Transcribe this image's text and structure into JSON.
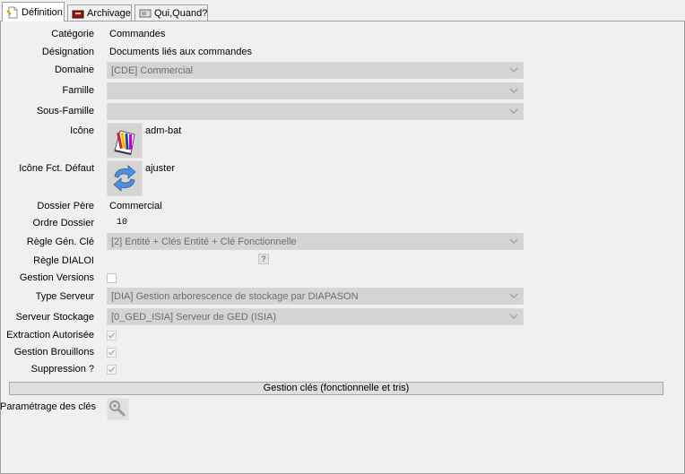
{
  "tabs": [
    {
      "label": "Définition",
      "icon": "document-icon",
      "active": true
    },
    {
      "label": "Archivage",
      "icon": "archive-box-icon",
      "active": false
    },
    {
      "label": "Qui,Quand?",
      "icon": "monitor-icon",
      "active": false
    }
  ],
  "form": {
    "categorie": {
      "label": "Catégorie",
      "value": "Commandes"
    },
    "designation": {
      "label": "Désignation",
      "value": "Documents liés aux commandes"
    },
    "domaine": {
      "label": "Domaine",
      "value": "[CDE] Commercial"
    },
    "famille": {
      "label": "Famille",
      "value": ""
    },
    "sous_famille": {
      "label": "Sous-Famille",
      "value": ""
    },
    "icone": {
      "label": "Icône",
      "value": "adm-bat",
      "icon": "pencils-icon"
    },
    "icone_fct": {
      "label": "Icône Fct. Défaut",
      "value": "ajuster",
      "icon": "refresh-arrows-icon"
    },
    "dossier_pere": {
      "label": "Dossier Père",
      "value": "Commercial"
    },
    "ordre_dossier": {
      "label": "Ordre Dossier",
      "value": "10"
    },
    "regle_gen_cle": {
      "label": "Règle Gén. Clé",
      "value": "[2] Entité + Clés Entité + Clé Fonctionnelle"
    },
    "regle_dialog": {
      "label": "Règle DIALOI",
      "button": "?"
    },
    "gestion_versions": {
      "label": "Gestion Versions",
      "checked": false
    },
    "type_serveur": {
      "label": "Type Serveur",
      "value": "[DIA] Gestion arborescence de stockage par DIAPASON"
    },
    "serveur_stockage": {
      "label": "Serveur Stockage",
      "value": "[0_GED_ISIA] Serveur de GED (ISIA)"
    },
    "extraction_autorisee": {
      "label": "Extraction Autorisée",
      "checked": true
    },
    "gestion_brouillons": {
      "label": "Gestion Brouillons",
      "checked": true
    },
    "suppression": {
      "label": "Suppression ?",
      "checked": true
    }
  },
  "gestion_cles_button": "Gestion clés (fonctionnelle et tris)",
  "parametrage_cles": {
    "label": "Paramétrage des clés",
    "icon": "wrench-key-icon"
  },
  "colors": {
    "panel_bg": "#f0f0f0",
    "combo_disabled_bg": "#d4d4d4",
    "combo_disabled_text": "#6d6d6d",
    "arrow_blue": "#4f8fd8"
  }
}
